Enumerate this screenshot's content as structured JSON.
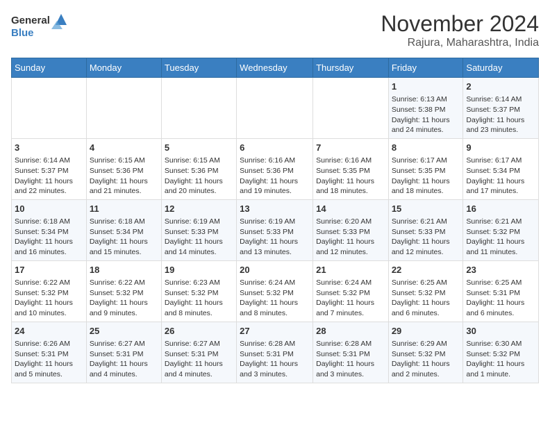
{
  "header": {
    "logo_line1": "General",
    "logo_line2": "Blue",
    "title": "November 2024",
    "subtitle": "Rajura, Maharashtra, India"
  },
  "columns": [
    "Sunday",
    "Monday",
    "Tuesday",
    "Wednesday",
    "Thursday",
    "Friday",
    "Saturday"
  ],
  "weeks": [
    [
      {
        "day": "",
        "info": ""
      },
      {
        "day": "",
        "info": ""
      },
      {
        "day": "",
        "info": ""
      },
      {
        "day": "",
        "info": ""
      },
      {
        "day": "",
        "info": ""
      },
      {
        "day": "1",
        "info": "Sunrise: 6:13 AM\nSunset: 5:38 PM\nDaylight: 11 hours and 24 minutes."
      },
      {
        "day": "2",
        "info": "Sunrise: 6:14 AM\nSunset: 5:37 PM\nDaylight: 11 hours and 23 minutes."
      }
    ],
    [
      {
        "day": "3",
        "info": "Sunrise: 6:14 AM\nSunset: 5:37 PM\nDaylight: 11 hours and 22 minutes."
      },
      {
        "day": "4",
        "info": "Sunrise: 6:15 AM\nSunset: 5:36 PM\nDaylight: 11 hours and 21 minutes."
      },
      {
        "day": "5",
        "info": "Sunrise: 6:15 AM\nSunset: 5:36 PM\nDaylight: 11 hours and 20 minutes."
      },
      {
        "day": "6",
        "info": "Sunrise: 6:16 AM\nSunset: 5:36 PM\nDaylight: 11 hours and 19 minutes."
      },
      {
        "day": "7",
        "info": "Sunrise: 6:16 AM\nSunset: 5:35 PM\nDaylight: 11 hours and 18 minutes."
      },
      {
        "day": "8",
        "info": "Sunrise: 6:17 AM\nSunset: 5:35 PM\nDaylight: 11 hours and 18 minutes."
      },
      {
        "day": "9",
        "info": "Sunrise: 6:17 AM\nSunset: 5:34 PM\nDaylight: 11 hours and 17 minutes."
      }
    ],
    [
      {
        "day": "10",
        "info": "Sunrise: 6:18 AM\nSunset: 5:34 PM\nDaylight: 11 hours and 16 minutes."
      },
      {
        "day": "11",
        "info": "Sunrise: 6:18 AM\nSunset: 5:34 PM\nDaylight: 11 hours and 15 minutes."
      },
      {
        "day": "12",
        "info": "Sunrise: 6:19 AM\nSunset: 5:33 PM\nDaylight: 11 hours and 14 minutes."
      },
      {
        "day": "13",
        "info": "Sunrise: 6:19 AM\nSunset: 5:33 PM\nDaylight: 11 hours and 13 minutes."
      },
      {
        "day": "14",
        "info": "Sunrise: 6:20 AM\nSunset: 5:33 PM\nDaylight: 11 hours and 12 minutes."
      },
      {
        "day": "15",
        "info": "Sunrise: 6:21 AM\nSunset: 5:33 PM\nDaylight: 11 hours and 12 minutes."
      },
      {
        "day": "16",
        "info": "Sunrise: 6:21 AM\nSunset: 5:32 PM\nDaylight: 11 hours and 11 minutes."
      }
    ],
    [
      {
        "day": "17",
        "info": "Sunrise: 6:22 AM\nSunset: 5:32 PM\nDaylight: 11 hours and 10 minutes."
      },
      {
        "day": "18",
        "info": "Sunrise: 6:22 AM\nSunset: 5:32 PM\nDaylight: 11 hours and 9 minutes."
      },
      {
        "day": "19",
        "info": "Sunrise: 6:23 AM\nSunset: 5:32 PM\nDaylight: 11 hours and 8 minutes."
      },
      {
        "day": "20",
        "info": "Sunrise: 6:24 AM\nSunset: 5:32 PM\nDaylight: 11 hours and 8 minutes."
      },
      {
        "day": "21",
        "info": "Sunrise: 6:24 AM\nSunset: 5:32 PM\nDaylight: 11 hours and 7 minutes."
      },
      {
        "day": "22",
        "info": "Sunrise: 6:25 AM\nSunset: 5:32 PM\nDaylight: 11 hours and 6 minutes."
      },
      {
        "day": "23",
        "info": "Sunrise: 6:25 AM\nSunset: 5:31 PM\nDaylight: 11 hours and 6 minutes."
      }
    ],
    [
      {
        "day": "24",
        "info": "Sunrise: 6:26 AM\nSunset: 5:31 PM\nDaylight: 11 hours and 5 minutes."
      },
      {
        "day": "25",
        "info": "Sunrise: 6:27 AM\nSunset: 5:31 PM\nDaylight: 11 hours and 4 minutes."
      },
      {
        "day": "26",
        "info": "Sunrise: 6:27 AM\nSunset: 5:31 PM\nDaylight: 11 hours and 4 minutes."
      },
      {
        "day": "27",
        "info": "Sunrise: 6:28 AM\nSunset: 5:31 PM\nDaylight: 11 hours and 3 minutes."
      },
      {
        "day": "28",
        "info": "Sunrise: 6:28 AM\nSunset: 5:31 PM\nDaylight: 11 hours and 3 minutes."
      },
      {
        "day": "29",
        "info": "Sunrise: 6:29 AM\nSunset: 5:32 PM\nDaylight: 11 hours and 2 minutes."
      },
      {
        "day": "30",
        "info": "Sunrise: 6:30 AM\nSunset: 5:32 PM\nDaylight: 11 hours and 1 minute."
      }
    ]
  ]
}
